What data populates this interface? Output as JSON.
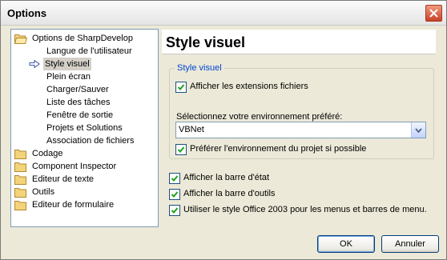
{
  "window": {
    "title": "Options"
  },
  "tree": {
    "root": "Options de SharpDevelop",
    "children": [
      "Langue de l'utilisateur",
      "Style visuel",
      "Plein écran",
      "Charger/Sauver",
      "Liste des tâches",
      "Fenêtre de sortie",
      "Projets et Solutions",
      "Association de fichiers"
    ],
    "selected": "Style visuel",
    "folders": [
      "Codage",
      "Component Inspector",
      "Editeur de texte",
      "Outils",
      "Editeur de formulaire"
    ]
  },
  "panel": {
    "title": "Style visuel",
    "group_title": "Style visuel",
    "show_extensions": "Afficher les extensions fichiers",
    "env_label": "Sélectionnez votre environnement préféré:",
    "env_value": "VBNet",
    "prefer_project_env": "Préférer l'environnement du projet si possible",
    "show_statusbar": "Afficher la barre d'état",
    "show_toolbar": "Afficher la barre d'outils",
    "office_style": "Utiliser le style Office 2003 pour les menus et barres de menu."
  },
  "buttons": {
    "ok": "OK",
    "cancel": "Annuler"
  }
}
